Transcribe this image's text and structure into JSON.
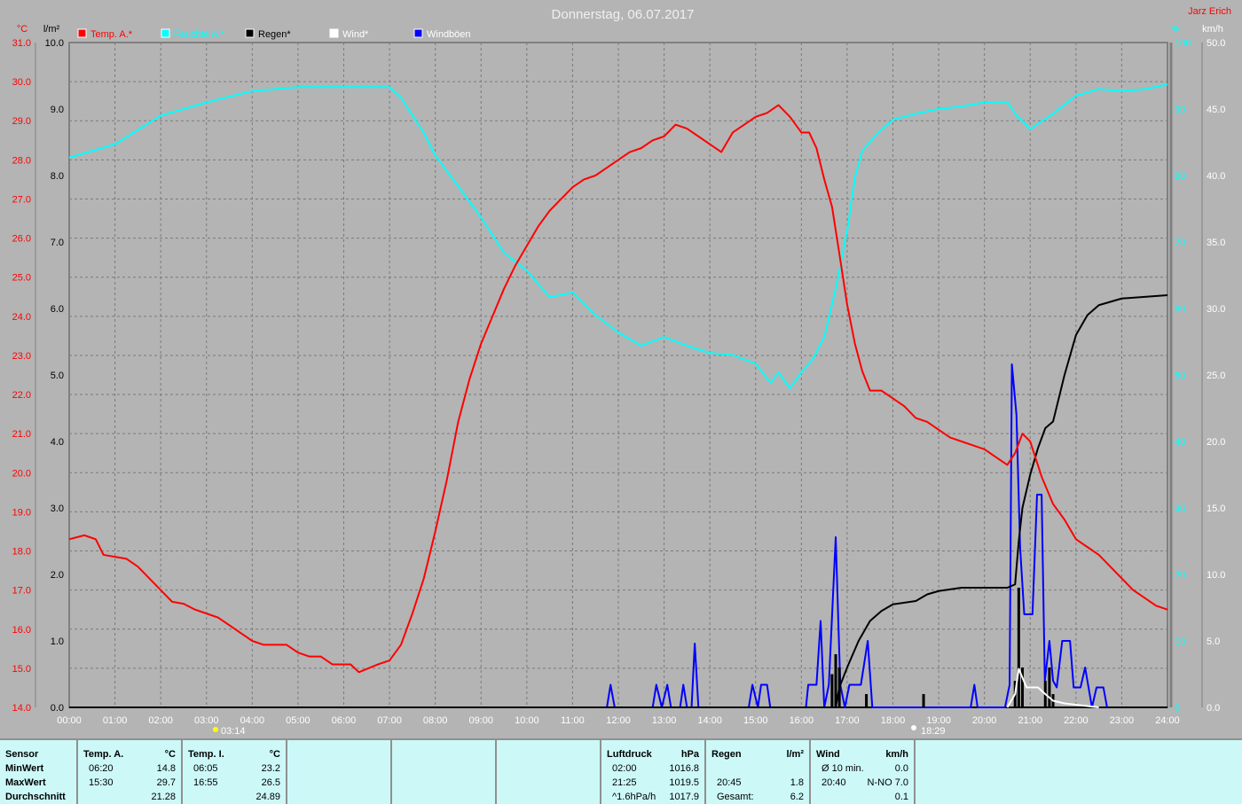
{
  "title": "Donnerstag, 06.07.2017",
  "owner": "Jarz Erich",
  "sunrise": "03:14",
  "sunset": "18:29",
  "colors": {
    "temp": "#ff0000",
    "humidity": "#00ffff",
    "rain": "#000000",
    "wind": "#ffffff",
    "gust": "#0000ff"
  },
  "chart_data": {
    "type": "line",
    "title": "Donnerstag, 06.07.2017",
    "legend": [
      {
        "name": "Temp. A.*",
        "color": "#ff0000"
      },
      {
        "name": "Feuchte A.*",
        "color": "#00ffff"
      },
      {
        "name": "Regen*",
        "color": "#000000"
      },
      {
        "name": "Wind*",
        "color": "#ffffff"
      },
      {
        "name": "Windböen",
        "color": "#0000ff"
      }
    ],
    "legend_placement": "top-left",
    "x_unit": "hours",
    "xlim": [
      0,
      24
    ],
    "x_ticks": [
      "00:00",
      "01:00",
      "02:00",
      "03:00",
      "04:00",
      "05:00",
      "06:00",
      "07:00",
      "08:00",
      "09:00",
      "10:00",
      "11:00",
      "12:00",
      "13:00",
      "14:00",
      "15:00",
      "16:00",
      "17:00",
      "18:00",
      "19:00",
      "20:00",
      "21:00",
      "22:00",
      "23:00",
      "24:00"
    ],
    "axes": {
      "temp": {
        "unit": "°C",
        "ylim": [
          14,
          31
        ],
        "ticks": [
          "14.0",
          "15.0",
          "16.0",
          "17.0",
          "18.0",
          "19.0",
          "20.0",
          "21.0",
          "22.0",
          "23.0",
          "24.0",
          "25.0",
          "26.0",
          "27.0",
          "28.0",
          "29.0",
          "30.0",
          "31.0"
        ]
      },
      "rain": {
        "unit": "l/m²",
        "ylim": [
          0,
          10
        ],
        "ticks": [
          "0.0",
          "1.0",
          "2.0",
          "3.0",
          "4.0",
          "5.0",
          "6.0",
          "7.0",
          "8.0",
          "9.0",
          "10.0"
        ]
      },
      "humidity": {
        "unit": "%",
        "ylim": [
          0,
          100
        ],
        "ticks": [
          "0",
          "10",
          "20",
          "30",
          "40",
          "50",
          "60",
          "70",
          "80",
          "90",
          "100"
        ]
      },
      "wind": {
        "unit": "km/h",
        "ylim": [
          0,
          50
        ],
        "ticks": [
          "0.0",
          "5.0",
          "10.0",
          "15.0",
          "20.0",
          "25.0",
          "30.0",
          "35.0",
          "40.0",
          "45.0",
          "50.0"
        ]
      }
    },
    "grid": true,
    "series": [
      {
        "name": "Temp. A.*",
        "axis": "temp",
        "points": [
          [
            0,
            18.3
          ],
          [
            0.33,
            18.4
          ],
          [
            0.58,
            18.3
          ],
          [
            0.75,
            17.9
          ],
          [
            1,
            17.85
          ],
          [
            1.25,
            17.8
          ],
          [
            1.5,
            17.6
          ],
          [
            1.75,
            17.3
          ],
          [
            2,
            17
          ],
          [
            2.25,
            16.7
          ],
          [
            2.5,
            16.65
          ],
          [
            2.75,
            16.5
          ],
          [
            3,
            16.4
          ],
          [
            3.25,
            16.3
          ],
          [
            3.5,
            16.1
          ],
          [
            3.75,
            15.9
          ],
          [
            4,
            15.7
          ],
          [
            4.25,
            15.6
          ],
          [
            4.75,
            15.6
          ],
          [
            5,
            15.4
          ],
          [
            5.25,
            15.3
          ],
          [
            5.5,
            15.3
          ],
          [
            5.75,
            15.1
          ],
          [
            6,
            15.1
          ],
          [
            6.15,
            15.1
          ],
          [
            6.33,
            14.9
          ],
          [
            6.75,
            15.1
          ],
          [
            7,
            15.2
          ],
          [
            7.25,
            15.6
          ],
          [
            7.5,
            16.4
          ],
          [
            7.75,
            17.3
          ],
          [
            8,
            18.5
          ],
          [
            8.25,
            19.8
          ],
          [
            8.5,
            21.3
          ],
          [
            8.75,
            22.4
          ],
          [
            9,
            23.3
          ],
          [
            9.25,
            24
          ],
          [
            9.5,
            24.7
          ],
          [
            9.75,
            25.3
          ],
          [
            10,
            25.8
          ],
          [
            10.25,
            26.3
          ],
          [
            10.5,
            26.7
          ],
          [
            10.75,
            27
          ],
          [
            11,
            27.3
          ],
          [
            11.25,
            27.5
          ],
          [
            11.5,
            27.6
          ],
          [
            11.75,
            27.8
          ],
          [
            12,
            28
          ],
          [
            12.25,
            28.2
          ],
          [
            12.5,
            28.3
          ],
          [
            12.75,
            28.5
          ],
          [
            13,
            28.6
          ],
          [
            13.25,
            28.9
          ],
          [
            13.5,
            28.8
          ],
          [
            13.75,
            28.6
          ],
          [
            14,
            28.4
          ],
          [
            14.25,
            28.2
          ],
          [
            14.5,
            28.7
          ],
          [
            14.75,
            28.9
          ],
          [
            15,
            29.1
          ],
          [
            15.25,
            29.2
          ],
          [
            15.5,
            29.4
          ],
          [
            15.75,
            29.1
          ],
          [
            16,
            28.7
          ],
          [
            16.17,
            28.7
          ],
          [
            16.33,
            28.3
          ],
          [
            16.5,
            27.5
          ],
          [
            16.67,
            26.8
          ],
          [
            16.83,
            25.6
          ],
          [
            17,
            24.3
          ],
          [
            17.17,
            23.3
          ],
          [
            17.33,
            22.6
          ],
          [
            17.5,
            22.1
          ],
          [
            17.75,
            22.1
          ],
          [
            18,
            21.9
          ],
          [
            18.25,
            21.7
          ],
          [
            18.5,
            21.4
          ],
          [
            18.75,
            21.3
          ],
          [
            19,
            21.1
          ],
          [
            19.25,
            20.9
          ],
          [
            19.5,
            20.8
          ],
          [
            19.75,
            20.7
          ],
          [
            20,
            20.6
          ],
          [
            20.25,
            20.4
          ],
          [
            20.5,
            20.2
          ],
          [
            20.67,
            20.5
          ],
          [
            20.83,
            21
          ],
          [
            21,
            20.8
          ],
          [
            21.25,
            19.9
          ],
          [
            21.5,
            19.2
          ],
          [
            21.75,
            18.8
          ],
          [
            22,
            18.3
          ],
          [
            22.25,
            18.1
          ],
          [
            22.5,
            17.9
          ],
          [
            22.75,
            17.6
          ],
          [
            23,
            17.3
          ],
          [
            23.25,
            17
          ],
          [
            23.5,
            16.8
          ],
          [
            23.75,
            16.6
          ],
          [
            24,
            16.5
          ]
        ]
      },
      {
        "name": "Feuchte A.*",
        "axis": "humidity",
        "points": [
          [
            0,
            82.7
          ],
          [
            1,
            84.7
          ],
          [
            2,
            89
          ],
          [
            3,
            91
          ],
          [
            4,
            92.7
          ],
          [
            5,
            93.3
          ],
          [
            6,
            93.3
          ],
          [
            7,
            93.3
          ],
          [
            7.25,
            91.7
          ],
          [
            7.75,
            86.4
          ],
          [
            8,
            83
          ],
          [
            8.5,
            78.4
          ],
          [
            9,
            73.7
          ],
          [
            9.5,
            68.4
          ],
          [
            10,
            65.7
          ],
          [
            10.5,
            61.7
          ],
          [
            11,
            62.4
          ],
          [
            11.5,
            59
          ],
          [
            12,
            56.4
          ],
          [
            12.5,
            54.4
          ],
          [
            13,
            55.7
          ],
          [
            13.5,
            54.4
          ],
          [
            14,
            53.3
          ],
          [
            14.5,
            53
          ],
          [
            15,
            51.7
          ],
          [
            15.33,
            48.8
          ],
          [
            15.5,
            50.4
          ],
          [
            15.75,
            48
          ],
          [
            16,
            50.4
          ],
          [
            16.25,
            52.4
          ],
          [
            16.5,
            55.7
          ],
          [
            16.75,
            63
          ],
          [
            17,
            71.7
          ],
          [
            17.17,
            79.7
          ],
          [
            17.33,
            83.7
          ],
          [
            17.67,
            86.4
          ],
          [
            18,
            88.4
          ],
          [
            18.5,
            89.3
          ],
          [
            19,
            90
          ],
          [
            19.5,
            90.4
          ],
          [
            20,
            91
          ],
          [
            20.5,
            91.1
          ],
          [
            20.67,
            89.3
          ],
          [
            21,
            87
          ],
          [
            21.5,
            89.3
          ],
          [
            22,
            92
          ],
          [
            22.5,
            93
          ],
          [
            23,
            92.7
          ],
          [
            23.5,
            93
          ],
          [
            24,
            93.7
          ]
        ]
      },
      {
        "name": "Regen*",
        "axis": "rain",
        "points": [
          [
            0,
            0
          ],
          [
            16.75,
            0
          ],
          [
            16.83,
            0.3
          ],
          [
            17,
            0.6
          ],
          [
            17.25,
            1
          ],
          [
            17.5,
            1.3
          ],
          [
            17.75,
            1.45
          ],
          [
            18,
            1.55
          ],
          [
            18.5,
            1.6
          ],
          [
            18.75,
            1.7
          ],
          [
            19,
            1.75
          ],
          [
            19.5,
            1.8
          ],
          [
            20,
            1.8
          ],
          [
            20.5,
            1.8
          ],
          [
            20.67,
            1.85
          ],
          [
            20.75,
            2.5
          ],
          [
            20.83,
            3
          ],
          [
            21,
            3.5
          ],
          [
            21.17,
            3.9
          ],
          [
            21.33,
            4.2
          ],
          [
            21.5,
            4.3
          ],
          [
            21.75,
            5
          ],
          [
            22,
            5.6
          ],
          [
            22.25,
            5.9
          ],
          [
            22.5,
            6.05
          ],
          [
            23,
            6.15
          ],
          [
            24,
            6.2
          ]
        ]
      },
      {
        "name": "Regen bars",
        "axis": "rain",
        "bars": [
          [
            16.67,
            0.5
          ],
          [
            16.75,
            0.8
          ],
          [
            16.83,
            0.6
          ],
          [
            17.42,
            0.2
          ],
          [
            18.67,
            0.2
          ],
          [
            20.67,
            0.4
          ],
          [
            20.75,
            1.8
          ],
          [
            20.83,
            0.6
          ],
          [
            21.33,
            0.4
          ],
          [
            21.42,
            0.6
          ],
          [
            21.5,
            0.2
          ]
        ]
      },
      {
        "name": "Wind*",
        "axis": "wind",
        "points": [
          [
            20.5,
            0
          ],
          [
            20.67,
            1
          ],
          [
            20.75,
            2.9
          ],
          [
            20.92,
            1.5
          ],
          [
            21.17,
            1.5
          ],
          [
            21.33,
            1
          ],
          [
            21.5,
            0.5
          ],
          [
            21.75,
            0.3
          ],
          [
            22,
            0.2
          ],
          [
            22.5,
            0
          ]
        ]
      },
      {
        "name": "Windböen",
        "axis": "wind",
        "points": [
          [
            11.75,
            0
          ],
          [
            11.83,
            1.7
          ],
          [
            11.92,
            0
          ],
          [
            12.75,
            0
          ],
          [
            12.83,
            1.7
          ],
          [
            12.95,
            0
          ],
          [
            13.07,
            1.7
          ],
          [
            13.15,
            0
          ],
          [
            13.35,
            0
          ],
          [
            13.42,
            1.7
          ],
          [
            13.5,
            0
          ],
          [
            13.6,
            0
          ],
          [
            13.67,
            4.8
          ],
          [
            13.75,
            0
          ],
          [
            14.85,
            0
          ],
          [
            14.93,
            1.7
          ],
          [
            15.05,
            0
          ],
          [
            15.12,
            1.7
          ],
          [
            15.25,
            1.7
          ],
          [
            15.32,
            0
          ],
          [
            16.1,
            0
          ],
          [
            16.15,
            1.7
          ],
          [
            16.33,
            1.7
          ],
          [
            16.42,
            6.5
          ],
          [
            16.5,
            0
          ],
          [
            16.6,
            1.7
          ],
          [
            16.75,
            12.8
          ],
          [
            16.85,
            1.7
          ],
          [
            16.95,
            0
          ],
          [
            17.05,
            1.7
          ],
          [
            17.3,
            1.7
          ],
          [
            17.45,
            5
          ],
          [
            17.55,
            0
          ],
          [
            19.7,
            0
          ],
          [
            19.78,
            1.7
          ],
          [
            19.85,
            0
          ],
          [
            20.45,
            0
          ],
          [
            20.55,
            1.7
          ],
          [
            20.6,
            25.8
          ],
          [
            20.7,
            22
          ],
          [
            20.78,
            12
          ],
          [
            20.87,
            7
          ],
          [
            21.05,
            7
          ],
          [
            21.15,
            16
          ],
          [
            21.25,
            16
          ],
          [
            21.32,
            2
          ],
          [
            21.42,
            5
          ],
          [
            21.5,
            2
          ],
          [
            21.58,
            1.5
          ],
          [
            21.7,
            5
          ],
          [
            21.87,
            5
          ],
          [
            21.95,
            1.5
          ],
          [
            22.1,
            1.5
          ],
          [
            22.2,
            3
          ],
          [
            22.35,
            0
          ],
          [
            22.45,
            1.5
          ],
          [
            22.6,
            1.5
          ],
          [
            22.68,
            0
          ]
        ]
      }
    ]
  },
  "table": {
    "sensor": {
      "header": "Sensor",
      "rows": [
        "MinWert",
        "MaxWert",
        "Durchschnitt"
      ]
    },
    "temp_a": {
      "header": "Temp. A.",
      "unit": "°C",
      "rows": [
        [
          "06:20",
          "14.8"
        ],
        [
          "15:30",
          "29.7"
        ],
        [
          "",
          "21.28"
        ]
      ]
    },
    "temp_i": {
      "header": "Temp. I.",
      "unit": "°C",
      "rows": [
        [
          "06:05",
          "23.2"
        ],
        [
          "16:55",
          "26.5"
        ],
        [
          "",
          "24.89"
        ]
      ]
    },
    "pressure": {
      "header": "Luftdruck",
      "unit": "hPa",
      "rows": [
        [
          "02:00",
          "1016.8"
        ],
        [
          "21:25",
          "1019.5"
        ],
        [
          "^1.6hPa/h",
          "1017.9"
        ]
      ]
    },
    "rain": {
      "header": "Regen",
      "unit": "l/m²",
      "rows": [
        [
          "",
          ""
        ],
        [
          "20:45",
          "1.8"
        ],
        [
          "Gesamt:",
          "6.2"
        ]
      ]
    },
    "wind": {
      "header": "Wind",
      "unit": "km/h",
      "rows": [
        [
          "Ø 10 min.",
          "0.0"
        ],
        [
          "20:40",
          "N-NO 7.0"
        ],
        [
          "",
          "0.1"
        ]
      ]
    }
  }
}
